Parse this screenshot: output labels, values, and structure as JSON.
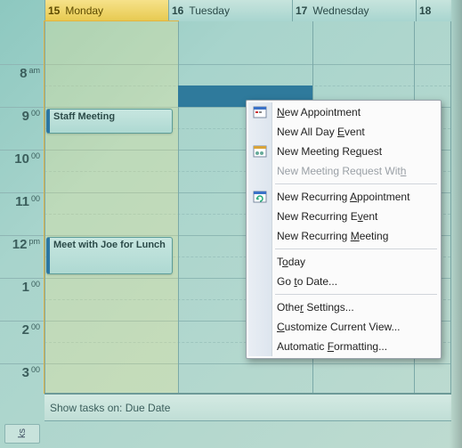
{
  "days": [
    {
      "num": "15",
      "name": "Monday",
      "today": true
    },
    {
      "num": "16",
      "name": "Tuesday",
      "today": false
    },
    {
      "num": "17",
      "name": "Wednesday",
      "today": false
    },
    {
      "num": "18",
      "name": "",
      "today": false,
      "narrow": true
    }
  ],
  "hours": [
    {
      "hh": "8",
      "mm": "am"
    },
    {
      "hh": "9",
      "mm": "00"
    },
    {
      "hh": "10",
      "mm": "00"
    },
    {
      "hh": "11",
      "mm": "00"
    },
    {
      "hh": "12",
      "mm": "pm"
    },
    {
      "hh": "1",
      "mm": "00"
    },
    {
      "hh": "2",
      "mm": "00"
    },
    {
      "hh": "3",
      "mm": "00"
    }
  ],
  "events": {
    "e0": {
      "title": "Staff Meeting"
    },
    "e1": {
      "title": "Meet with Joe for Lunch"
    }
  },
  "tasks_bar": "Show tasks on: Due Date",
  "tasks_tab": "ks",
  "menu": {
    "new_appointment": "New Appointment",
    "new_allday": "New All Day Event",
    "new_meeting": "New Meeting Request",
    "new_meeting_with": "New Meeting Request With",
    "rec_appt": "New Recurring Appointment",
    "rec_event": "New Recurring Event",
    "rec_meeting": "New Recurring Meeting",
    "today": "Today",
    "goto": "Go to Date...",
    "other": "Other Settings...",
    "custom": "Customize Current View...",
    "autofmt": "Automatic Formatting..."
  }
}
